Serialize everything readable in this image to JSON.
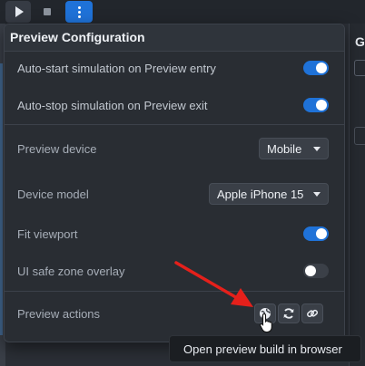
{
  "colors": {
    "accent": "#1f72d8",
    "panel": "#292d33",
    "annotation_arrow": "#e5201b"
  },
  "toolbar": {
    "play_icon": "play-icon",
    "stop_icon": "stop-icon",
    "more_icon": "kebab-menu-icon"
  },
  "background_panel": {
    "title_fragment": "G"
  },
  "popup": {
    "title": "Preview Configuration",
    "settings": {
      "auto_start": {
        "label": "Auto-start simulation on Preview entry",
        "enabled": true
      },
      "auto_stop": {
        "label": "Auto-stop simulation on Preview exit",
        "enabled": true
      },
      "preview_device": {
        "label": "Preview device",
        "value": "Mobile"
      },
      "device_model": {
        "label": "Device model",
        "value": "Apple iPhone 15"
      },
      "fit_viewport": {
        "label": "Fit viewport",
        "enabled": true
      },
      "ui_safe_zone": {
        "label": "UI safe zone overlay",
        "enabled": false
      }
    },
    "preview_actions": {
      "label": "Preview actions",
      "buttons": [
        "open-in-browser-icon",
        "refresh-icon",
        "link-icon"
      ]
    }
  },
  "tooltip": {
    "text": "Open preview build in browser"
  }
}
